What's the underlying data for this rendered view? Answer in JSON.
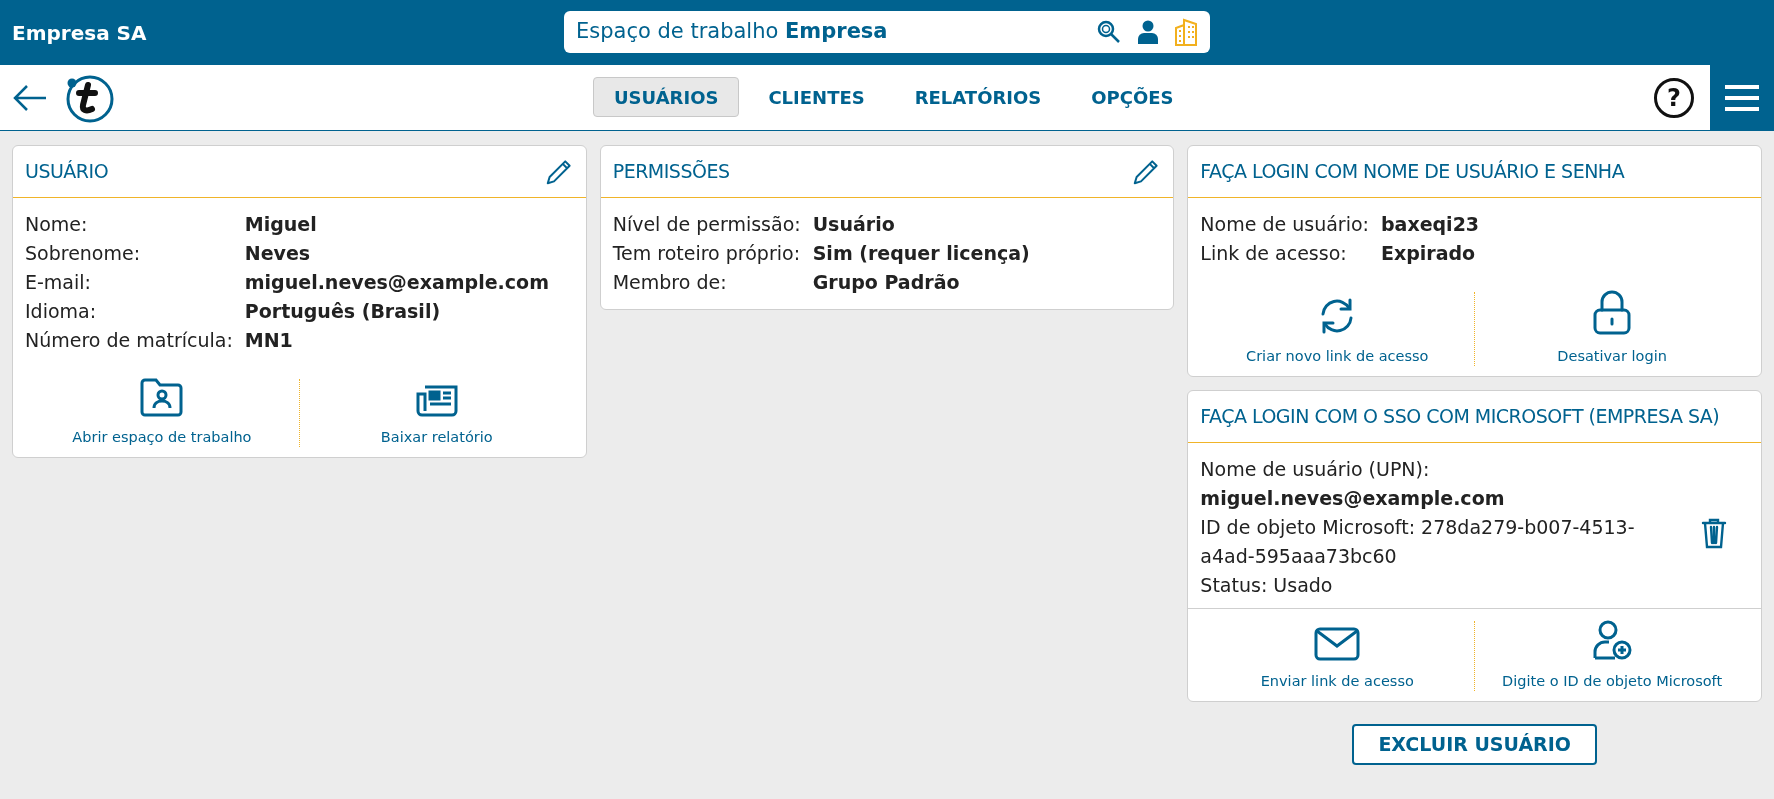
{
  "header": {
    "title": "Empresa SA",
    "workspace": "Espaço de trabalho **Empresa**"
  },
  "nav": {
    "tabs": [
      {
        "label": "USUÁRIOS",
        "selected": true
      },
      {
        "label": "CLIENTES",
        "selected": false
      },
      {
        "label": "RELATÓRIOS",
        "selected": false
      },
      {
        "label": "OPÇÕES",
        "selected": false
      }
    ],
    "help": "?"
  },
  "columns": [
    [
      {
        "kind": "fields",
        "title": "USUÁRIO",
        "editable": true,
        "fields": [
          {
            "label": "Nome:",
            "value": "Miguel"
          },
          {
            "label": "Sobrenome:",
            "value": "Neves"
          },
          {
            "label": "E-mail:",
            "value": "miguel.neves@example.com"
          },
          {
            "label": "Idioma:",
            "value": "Português (Brasil)"
          },
          {
            "label": "Número de matrícula:",
            "value": "MN1"
          }
        ],
        "actions": [
          "Abrir espaço de trabalho",
          "Baixar relatório"
        ]
      }
    ],
    [
      {
        "kind": "fields",
        "title": "PERMISSÕES",
        "editable": true,
        "fields": [
          {
            "label": "Nível de permissão:",
            "value": "Usuário"
          },
          {
            "label": "Tem roteiro próprio:",
            "value": "Sim (requer licença)"
          },
          {
            "label": "Membro de:",
            "value": "Grupo Padrão"
          }
        ]
      }
    ],
    [
      {
        "kind": "fields",
        "title": "FAÇA LOGIN COM NOME DE USUÁRIO E SENHA",
        "editable": false,
        "fields": [
          {
            "label": "Nome de usuário:",
            "value": "baxeqi23"
          },
          {
            "label": "Link de acesso:",
            "value": "Expirado"
          }
        ],
        "actions": [
          "Criar novo link de acesso",
          "Desativar login"
        ]
      },
      {
        "kind": "sso",
        "title": "FAÇA LOGIN COM O SSO COM MICROSOFT (EMPRESA SA)",
        "editable": false,
        "lines": [
          "Nome de usuário (UPN):",
          "**miguel.neves@example.com**",
          "ID de objeto Microsoft: 278da279-b007-4513-a4ad-595aaa73bc60",
          "Status: Usado"
        ],
        "actions": [
          "Enviar link de acesso",
          "Digite o ID de objeto Microsoft"
        ]
      }
    ]
  ],
  "delete_button": "EXCLUIR USUÁRIO"
}
